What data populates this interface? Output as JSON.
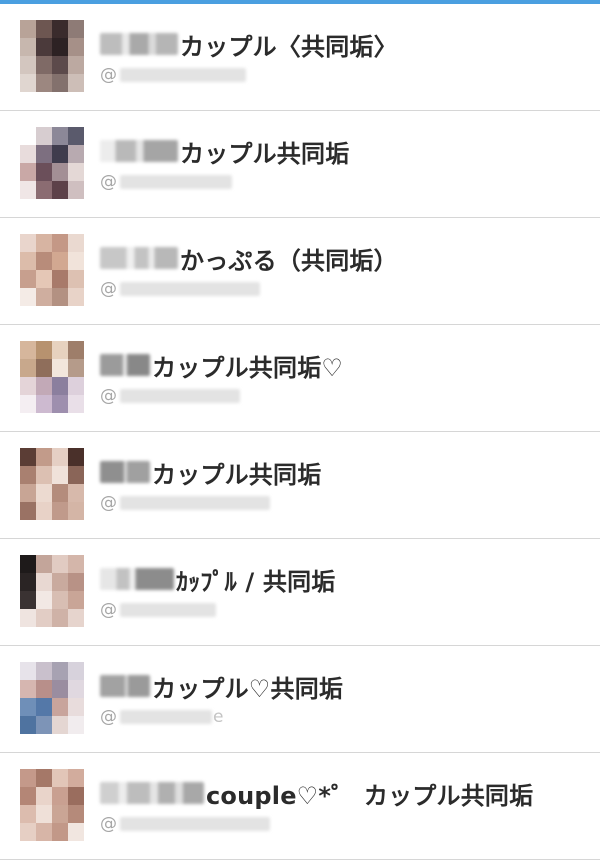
{
  "header": {
    "accent_color": "#4a9fe0"
  },
  "accounts": [
    {
      "name": "カップル〈共同垢〉",
      "handle_prefix": "@",
      "handle_visible": "",
      "avatar_colors": [
        "#b8a398",
        "#6d5651",
        "#3a2b2c",
        "#8e7b76",
        "#c7b7ae",
        "#4b3a3b",
        "#2d2224",
        "#a69088",
        "#d3c6bf",
        "#7f6a66",
        "#5c4a4b",
        "#bca9a1",
        "#e0d6d0",
        "#9c8780",
        "#83716d",
        "#cdbeb7"
      ]
    },
    {
      "name": "カップル共同垢",
      "handle_prefix": "@",
      "handle_visible": "",
      "avatar_colors": [
        "#ffffff",
        "#d7cdd0",
        "#8c8898",
        "#5a5a6c",
        "#e8dcdc",
        "#7d6f80",
        "#3f3c4d",
        "#b8aab0",
        "#c9a8a6",
        "#6b4f5a",
        "#a38f95",
        "#e4d8d6",
        "#f0e6e6",
        "#8b6c72",
        "#5d4149",
        "#cfbfc0"
      ]
    },
    {
      "name": "かっぷる（共同垢）",
      "handle_prefix": "@",
      "handle_visible": "",
      "avatar_colors": [
        "#e9d5cc",
        "#d7b4a2",
        "#c49886",
        "#ead9d0",
        "#dcbcaa",
        "#b88c7a",
        "#d2a891",
        "#f1e3da",
        "#c79f8e",
        "#e5c7b6",
        "#a87a6a",
        "#ddc1b2",
        "#f4ebe6",
        "#cfae9f",
        "#b39182",
        "#e8d3c8"
      ]
    },
    {
      "name": "カップル共同垢♡",
      "handle_prefix": "@",
      "handle_visible": "",
      "avatar_colors": [
        "#d6b69c",
        "#b7926f",
        "#e7d2bf",
        "#9e7e6a",
        "#c8a88c",
        "#8f6e5b",
        "#f2e6dc",
        "#b59b8a",
        "#e4d4d8",
        "#c2a9b7",
        "#8b7f9e",
        "#ddd0dc",
        "#f4eef2",
        "#cdbad0",
        "#9e8fae",
        "#e9dfe8"
      ]
    },
    {
      "name": "カップル共同垢",
      "handle_prefix": "@",
      "handle_visible": "",
      "avatar_colors": [
        "#5b3d35",
        "#c29b8a",
        "#e5cfc4",
        "#4a302a",
        "#a98070",
        "#dcc0b2",
        "#f0e2da",
        "#8a6558",
        "#c8a595",
        "#ecdad0",
        "#b48c7c",
        "#d7b9ab",
        "#9a7264",
        "#e8d2c7",
        "#c09a8b",
        "#d4b5a6"
      ]
    },
    {
      "name": "ｶｯﾌﾟﾙ / 共同垢",
      "handle_prefix": "@",
      "handle_visible": "",
      "avatar_colors": [
        "#1e1a1a",
        "#c3a59a",
        "#e1cbc2",
        "#d4b6aa",
        "#2a2424",
        "#e8d8d2",
        "#c9aa9e",
        "#b89286",
        "#3a3232",
        "#f2e8e4",
        "#d8beb3",
        "#c9a597",
        "#efe4e0",
        "#e2cdc5",
        "#cfb2a7",
        "#e6d4cd"
      ]
    },
    {
      "name": "カップル♡共同垢",
      "handle_prefix": "@",
      "handle_visible": "e",
      "avatar_colors": [
        "#e7e3ea",
        "#c9c0cc",
        "#a7a2b2",
        "#d7d2dc",
        "#d6b6b0",
        "#b88f8a",
        "#9a8da0",
        "#e0d8e0",
        "#6f8fb8",
        "#5478a8",
        "#c8a49c",
        "#e8dcdc",
        "#4f73a0",
        "#7d94b7",
        "#e4d6d2",
        "#f1ecee"
      ]
    },
    {
      "name": "couple♡*゜ カップル共同垢",
      "handle_prefix": "@",
      "handle_visible": "",
      "avatar_colors": [
        "#c4998a",
        "#a57868",
        "#e2c6b8",
        "#d2ac9d",
        "#b48676",
        "#e9d4ca",
        "#c9a091",
        "#9a6d5e",
        "#dcbcae",
        "#efe0d8",
        "#caa595",
        "#b58a7a",
        "#e6cfc4",
        "#d7b5a7",
        "#c29888",
        "#f1e6e0"
      ]
    }
  ]
}
